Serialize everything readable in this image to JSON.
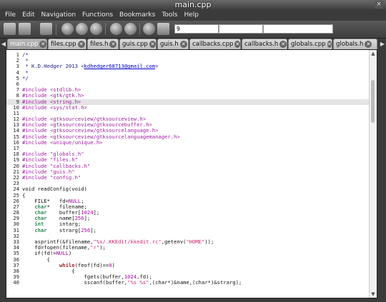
{
  "window": {
    "title": "main.cpp"
  },
  "menubar": {
    "items": [
      "File",
      "Edit",
      "Navigation",
      "Functions",
      "Bookmarks",
      "Tools",
      "Help"
    ]
  },
  "toolbar": {
    "goto_line_value": "9",
    "find_value": "",
    "replace_value": ""
  },
  "tabs": [
    {
      "label": "main.cpp",
      "active": true
    },
    {
      "label": "files.cpp"
    },
    {
      "label": "files.h"
    },
    {
      "label": "guis.cpp"
    },
    {
      "label": "guis.h"
    },
    {
      "label": "callbacks.cpp"
    },
    {
      "label": "callbacks.h"
    },
    {
      "label": "globals.cpp"
    },
    {
      "label": "globals.h"
    }
  ],
  "editor": {
    "highlighted_line": 9,
    "lines": [
      {
        "n": "1",
        "segs": [
          [
            "cm",
            "/*"
          ]
        ]
      },
      {
        "n": "2",
        "segs": [
          [
            "cm",
            " *"
          ]
        ]
      },
      {
        "n": "3",
        "segs": [
          [
            "cm",
            " * K.D.Hedger 2013 <"
          ],
          [
            "lnk",
            "kdhedger68713@gmail.com"
          ],
          [
            "cm",
            ">"
          ]
        ]
      },
      {
        "n": "4",
        "segs": [
          [
            "cm",
            " *"
          ]
        ]
      },
      {
        "n": "5",
        "segs": [
          [
            "cm",
            "*/"
          ]
        ]
      },
      {
        "n": "6",
        "segs": []
      },
      {
        "n": "7",
        "segs": [
          [
            "pp",
            "#include <stdlib.h>"
          ]
        ]
      },
      {
        "n": "8",
        "segs": [
          [
            "pp",
            "#include <gtk/gtk.h>"
          ]
        ]
      },
      {
        "n": "9",
        "segs": [
          [
            "pp",
            "#include <string.h>"
          ]
        ]
      },
      {
        "n": "10",
        "segs": [
          [
            "pp",
            "#include <sys/stat.h>"
          ]
        ]
      },
      {
        "n": "11",
        "segs": []
      },
      {
        "n": "12",
        "segs": [
          [
            "pp",
            "#include <gtksourceview/gtksourceview.h>"
          ]
        ]
      },
      {
        "n": "13",
        "segs": [
          [
            "pp",
            "#include <gtksourceview/gtksourcebuffer.h>"
          ]
        ]
      },
      {
        "n": "14",
        "segs": [
          [
            "pp",
            "#include <gtksourceview/gtksourcelanguage.h>"
          ]
        ]
      },
      {
        "n": "15",
        "segs": [
          [
            "pp",
            "#include <gtksourceview/gtksourcelanguagemanager.h>"
          ]
        ]
      },
      {
        "n": "16",
        "segs": [
          [
            "pp",
            "#include <unique/unique.h>"
          ]
        ]
      },
      {
        "n": "17",
        "segs": []
      },
      {
        "n": "18",
        "segs": [
          [
            "pp",
            "#include \"globals.h\""
          ]
        ]
      },
      {
        "n": "19",
        "segs": [
          [
            "pp",
            "#include \"files.h\""
          ]
        ]
      },
      {
        "n": "20",
        "segs": [
          [
            "pp",
            "#include \"callbacks.h\""
          ]
        ]
      },
      {
        "n": "21",
        "segs": [
          [
            "pp",
            "#include \"guis.h\""
          ]
        ]
      },
      {
        "n": "22",
        "segs": [
          [
            "pp",
            "#include \"config.h\""
          ]
        ]
      },
      {
        "n": "23",
        "segs": []
      },
      {
        "n": "24",
        "segs": [
          [
            "code",
            "void readConfig(void)"
          ]
        ]
      },
      {
        "n": "25",
        "segs": [
          [
            "code",
            "{"
          ]
        ]
      },
      {
        "n": "26",
        "segs": [
          [
            "code",
            "    FILE*   fd="
          ],
          [
            "num",
            "NULL"
          ],
          [
            "code",
            ";"
          ]
        ]
      },
      {
        "n": "27",
        "segs": [
          [
            "code",
            "    "
          ],
          [
            "ty",
            "char"
          ],
          [
            "code",
            "*   filename;"
          ]
        ]
      },
      {
        "n": "28",
        "segs": [
          [
            "code",
            "    "
          ],
          [
            "ty",
            "char"
          ],
          [
            "code",
            "    buffer["
          ],
          [
            "num",
            "1024"
          ],
          [
            "code",
            "];"
          ]
        ]
      },
      {
        "n": "29",
        "segs": [
          [
            "code",
            "    "
          ],
          [
            "ty",
            "char"
          ],
          [
            "code",
            "    name["
          ],
          [
            "num",
            "256"
          ],
          [
            "code",
            "];"
          ]
        ]
      },
      {
        "n": "30",
        "segs": [
          [
            "code",
            "    "
          ],
          [
            "ty",
            "int"
          ],
          [
            "code",
            "     intarg;"
          ]
        ]
      },
      {
        "n": "31",
        "segs": [
          [
            "code",
            "    "
          ],
          [
            "ty",
            "char"
          ],
          [
            "code",
            "    strarg["
          ],
          [
            "num",
            "256"
          ],
          [
            "code",
            "];"
          ]
        ]
      },
      {
        "n": "32",
        "segs": []
      },
      {
        "n": "33",
        "segs": [
          [
            "code",
            "    asprintf(&filename,"
          ],
          [
            "str",
            "\"%s/.KKEdit/kkedit.rc\""
          ],
          [
            "code",
            ",getenv("
          ],
          [
            "str",
            "\"HOME\""
          ],
          [
            "code",
            "));"
          ]
        ]
      },
      {
        "n": "34",
        "segs": [
          [
            "code",
            "    fd=fopen(filename,"
          ],
          [
            "str",
            "\"r\""
          ],
          [
            "code",
            ");"
          ]
        ]
      },
      {
        "n": "35",
        "segs": [
          [
            "code",
            "    if(fd!="
          ],
          [
            "num",
            "NULL"
          ],
          [
            "code",
            ")"
          ]
        ]
      },
      {
        "n": "36",
        "segs": [
          [
            "code",
            "        {"
          ]
        ]
      },
      {
        "n": "37",
        "segs": [
          [
            "code",
            "            "
          ],
          [
            "kw",
            "while"
          ],
          [
            "code",
            "(feof(fd)=="
          ],
          [
            "num",
            "0"
          ],
          [
            "code",
            ")"
          ]
        ]
      },
      {
        "n": "38",
        "segs": [
          [
            "code",
            "                {"
          ]
        ]
      },
      {
        "n": "39",
        "segs": [
          [
            "code",
            "                    fgets(buffer,"
          ],
          [
            "num",
            "1024"
          ],
          [
            "code",
            ",fd);"
          ]
        ]
      },
      {
        "n": "40",
        "segs": [
          [
            "code",
            "                    sscanf(buffer,"
          ],
          [
            "str",
            "\"%s %s\""
          ],
          [
            "code",
            ",(char*)&name,(char*)&strarg);"
          ]
        ]
      }
    ]
  }
}
